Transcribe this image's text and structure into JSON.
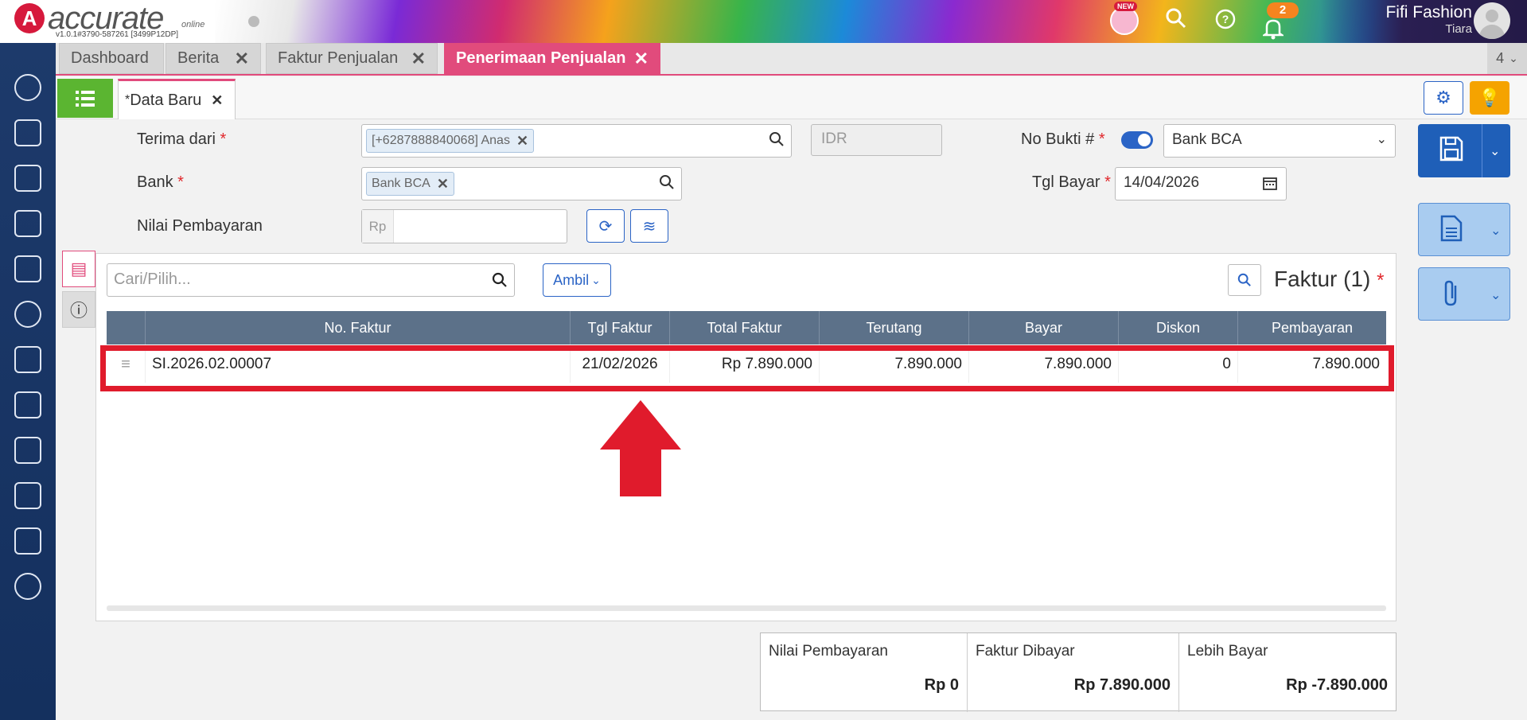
{
  "app": {
    "logo_text": "accurate",
    "logo_online": "online",
    "version": "v1.0.1#3790-587261 [3499P12DP]",
    "new_badge": "NEW",
    "notification_count": "2",
    "company": "Fifi Fashion",
    "user": "Tiara"
  },
  "tabs": [
    {
      "label": "Dashboard"
    },
    {
      "label": "Berita"
    },
    {
      "label": "Faktur Penjualan"
    },
    {
      "label": "Penerimaan Penjualan"
    }
  ],
  "tab_count": "4",
  "subtab": {
    "asterisk": "*",
    "label": "Data Baru"
  },
  "form": {
    "terima_dari_label": "Terima dari",
    "terima_dari_value": "[+6287888840068] Anas",
    "currency": "IDR",
    "no_bukti_label": "No Bukti #",
    "no_bukti_value": "Bank BCA",
    "bank_label": "Bank",
    "bank_value": "Bank BCA",
    "tgl_bayar_label": "Tgl Bayar",
    "tgl_bayar_value": "14/04/2026",
    "nilai_label": "Nilai Pembayaran",
    "nilai_prefix": "Rp",
    "required_mark": "*"
  },
  "panel": {
    "search_placeholder": "Cari/Pilih...",
    "ambil_label": "Ambil",
    "title": "Faktur (1)",
    "required_mark": "*"
  },
  "table": {
    "columns": [
      "No. Faktur",
      "Tgl Faktur",
      "Total Faktur",
      "Terutang",
      "Bayar",
      "Diskon",
      "Pembayaran"
    ],
    "rows": [
      {
        "no_faktur": "SI.2026.02.00007",
        "tgl": "21/02/2026",
        "total": "Rp 7.890.000",
        "terutang": "7.890.000",
        "bayar": "7.890.000",
        "diskon": "0",
        "pembayaran": "7.890.000"
      }
    ]
  },
  "summary": [
    {
      "label": "Nilai Pembayaran",
      "value": "Rp 0"
    },
    {
      "label": "Faktur Dibayar",
      "value": "Rp 7.890.000"
    },
    {
      "label": "Lebih Bayar",
      "value": "Rp -7.890.000"
    }
  ],
  "colors": {
    "accent_pink": "#e14b7c",
    "primary_blue": "#1f5fb8",
    "highlight_red": "#e01b2c",
    "list_green": "#5bb531",
    "bulb_orange": "#f5a300"
  }
}
